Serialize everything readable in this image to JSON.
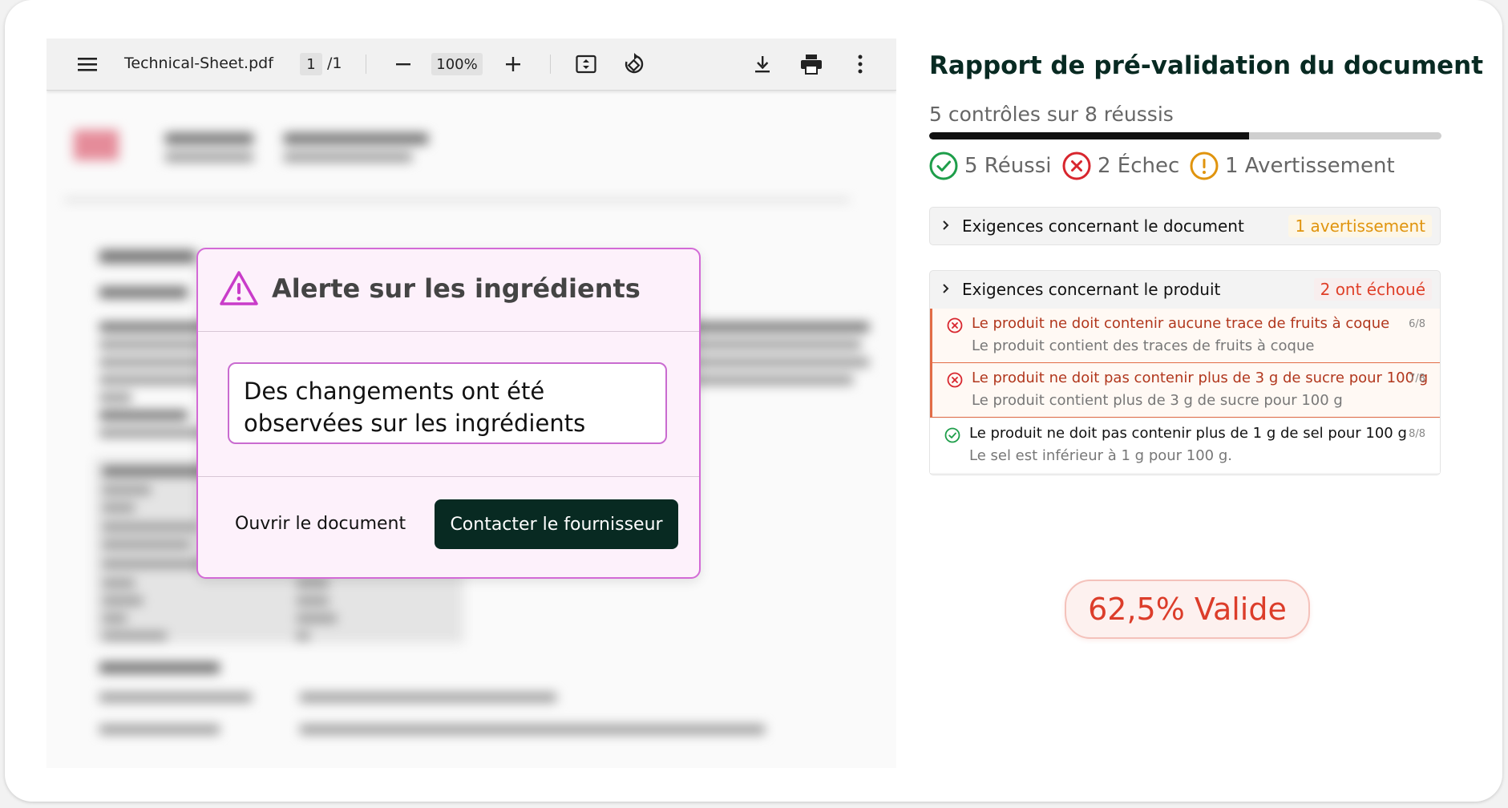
{
  "viewer": {
    "filename": "Technical-Sheet.pdf",
    "page_current": "1",
    "page_total": "/1",
    "zoom": "100%",
    "icons": [
      "menu-icon",
      "zoom-out-icon",
      "zoom-in-icon",
      "fit-page-icon",
      "rotate-icon",
      "download-icon",
      "print-icon",
      "more-vert-icon"
    ]
  },
  "modal": {
    "title": "Alerte sur les ingrédients",
    "message_line1": "Des changements ont été",
    "message_line2": "observées sur les ingrédients",
    "open_label": "Ouvrir le document",
    "contact_label": "Contacter le fournisseur",
    "accent": "#d36ad6"
  },
  "report": {
    "title": "Rapport de pré-validation du document",
    "summary": "5 contrôles sur 8 réussis",
    "progress_fraction": 0.625,
    "stats": {
      "pass": "5 Réussi",
      "fail": "2 Échec",
      "warn": "1 Avertissement"
    },
    "sections": [
      {
        "label": "Exigences concernant le document",
        "badge": "1 avertissement",
        "badge_type": "warn"
      },
      {
        "label": "Exigences concernant le produit",
        "badge": "2 ont échoué",
        "badge_type": "fail",
        "items": [
          {
            "status": "fail",
            "title": "Le produit ne doit contenir aucune trace de fruits à coque",
            "detail": "Le produit contient des traces de fruits à coque",
            "num": "6/8"
          },
          {
            "status": "fail",
            "title": "Le produit ne doit pas contenir plus de 3 g de sucre pour 100 g",
            "detail": "Le produit contient plus de 3 g de sucre pour 100 g",
            "num": "7/8"
          },
          {
            "status": "pass",
            "title": "Le produit ne doit pas contenir plus de 1 g de sel pour 100 g",
            "detail": "Le sel est inférieur à 1 g pour 100 g.",
            "num": "8/8"
          }
        ]
      }
    ],
    "validity": "62,5% Valide",
    "colors": {
      "pass": "#1e9e4a",
      "fail": "#d8262e",
      "warn": "#e0940e",
      "dark": "#082a22"
    }
  }
}
